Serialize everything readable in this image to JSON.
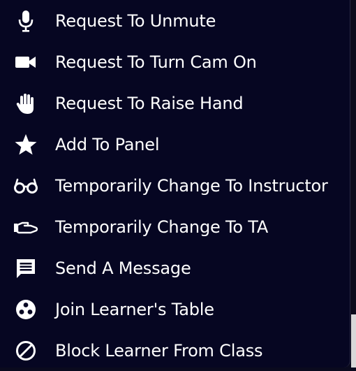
{
  "menu": {
    "items": [
      {
        "label": "Request To Unmute",
        "icon": "microphone-icon"
      },
      {
        "label": "Request To Turn Cam On",
        "icon": "video-camera-icon"
      },
      {
        "label": "Request To Raise Hand",
        "icon": "raised-hand-icon"
      },
      {
        "label": "Add To Panel",
        "icon": "star-icon"
      },
      {
        "label": "Temporarily Change To Instructor",
        "icon": "glasses-icon"
      },
      {
        "label": "Temporarily Change To TA",
        "icon": "helping-hand-icon"
      },
      {
        "label": "Send A Message",
        "icon": "message-icon"
      },
      {
        "label": "Join Learner's Table",
        "icon": "table-icon"
      },
      {
        "label": "Block Learner From Class",
        "icon": "block-icon"
      }
    ]
  },
  "colors": {
    "background": "#060622",
    "text": "#ffffff"
  }
}
